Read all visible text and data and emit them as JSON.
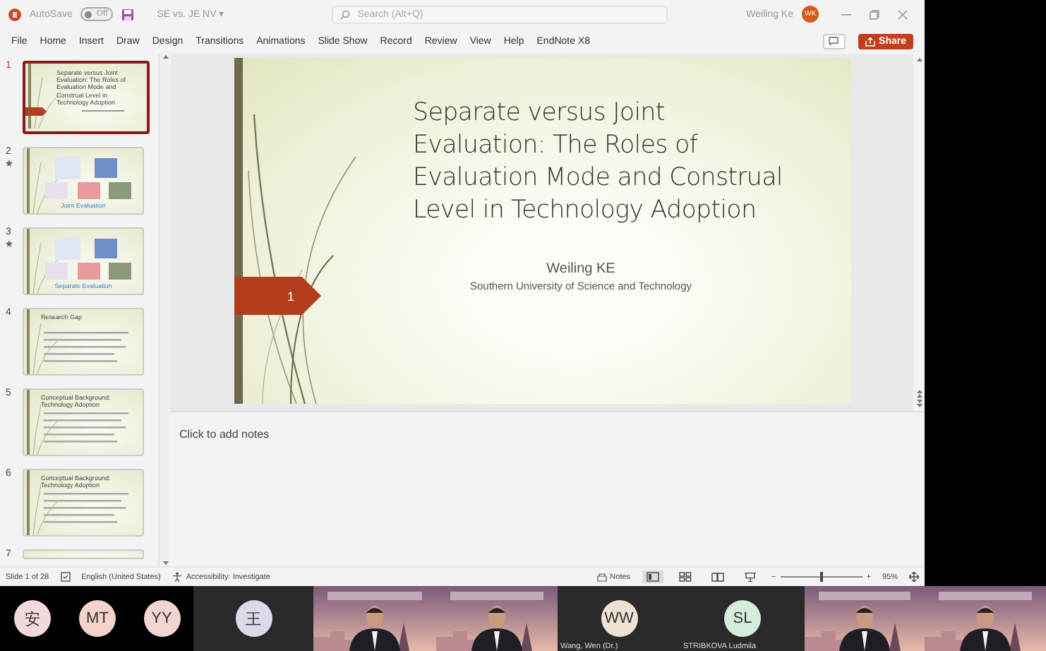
{
  "titlebar": {
    "autosave_label": "AutoSave",
    "autosave_toggle": {
      "label": "Off",
      "on": false
    },
    "file_name": "SE vs. JE NV ▾",
    "search": {
      "placeholder": "Search (Alt+Q)"
    },
    "user_name": "Weiling Ke",
    "user_initials": "WK"
  },
  "ribbon_tabs": [
    "File",
    "Home",
    "Insert",
    "Draw",
    "Design",
    "Transitions",
    "Animations",
    "Slide Show",
    "Record",
    "Review",
    "View",
    "Help",
    "EndNote X8"
  ],
  "share_button": "Share",
  "thumbnails": [
    {
      "number": "1",
      "selected": true,
      "animated": false,
      "kind": "title",
      "title": "Separate versus Joint Evaluation: The Roles of Evaluation Mode and Construal Level in Technology Adoption"
    },
    {
      "number": "2",
      "selected": false,
      "animated": true,
      "kind": "images",
      "title": "Joint Evaluation"
    },
    {
      "number": "3",
      "selected": false,
      "animated": true,
      "kind": "images",
      "title": "Separate Evaluation"
    },
    {
      "number": "4",
      "selected": false,
      "animated": false,
      "kind": "bullets",
      "title": "Research Gap"
    },
    {
      "number": "5",
      "selected": false,
      "animated": false,
      "kind": "bullets",
      "title": "Conceptual Background: Technology Adoption"
    },
    {
      "number": "6",
      "selected": false,
      "animated": false,
      "kind": "bullets",
      "title": "Conceptual Background: Technology Adoption"
    },
    {
      "number": "7",
      "selected": false,
      "animated": false,
      "kind": "cut"
    }
  ],
  "slide": {
    "number": "1",
    "title": "Separate versus Joint\nEvaluation: The Roles of\nEvaluation Mode and Construal\nLevel in Technology Adoption",
    "author": "Weiling KE",
    "affiliation": "Southern University of Science and Technology"
  },
  "notes": {
    "placeholder": "Click to add notes"
  },
  "status_bar": {
    "slide_info": "Slide 1 of 28",
    "language": "English (United States)",
    "accessibility": "Accessibility: Investigate",
    "notes_button": "Notes",
    "views": [
      {
        "kind": "normal",
        "selected": true
      },
      {
        "kind": "sorter",
        "selected": false
      },
      {
        "kind": "reading",
        "selected": false
      },
      {
        "kind": "slideshow",
        "selected": false
      }
    ],
    "zoom": {
      "minus": "−",
      "plus": "+",
      "level": 0.5,
      "reading": "95%"
    }
  },
  "participants": [
    {
      "kind": "avatar",
      "initials": "安",
      "color": "#f3d8dc"
    },
    {
      "kind": "avatar",
      "initials": "MT",
      "color": "#f5d3cd"
    },
    {
      "kind": "avatar",
      "initials": "YY",
      "color": "#f3d6d2"
    },
    {
      "kind": "avatar",
      "initials": "王",
      "color": "#dcd9e9"
    },
    {
      "kind": "video"
    },
    {
      "kind": "video"
    },
    {
      "kind": "avatar",
      "initials": "WW",
      "color": "#efe2d4",
      "name": "Wang, Wen (Dr.)"
    },
    {
      "kind": "avatar",
      "initials": "SL",
      "color": "#d5ecdc",
      "name": "STRIBKOVA Ludmila"
    },
    {
      "kind": "video"
    },
    {
      "kind": "video"
    }
  ]
}
